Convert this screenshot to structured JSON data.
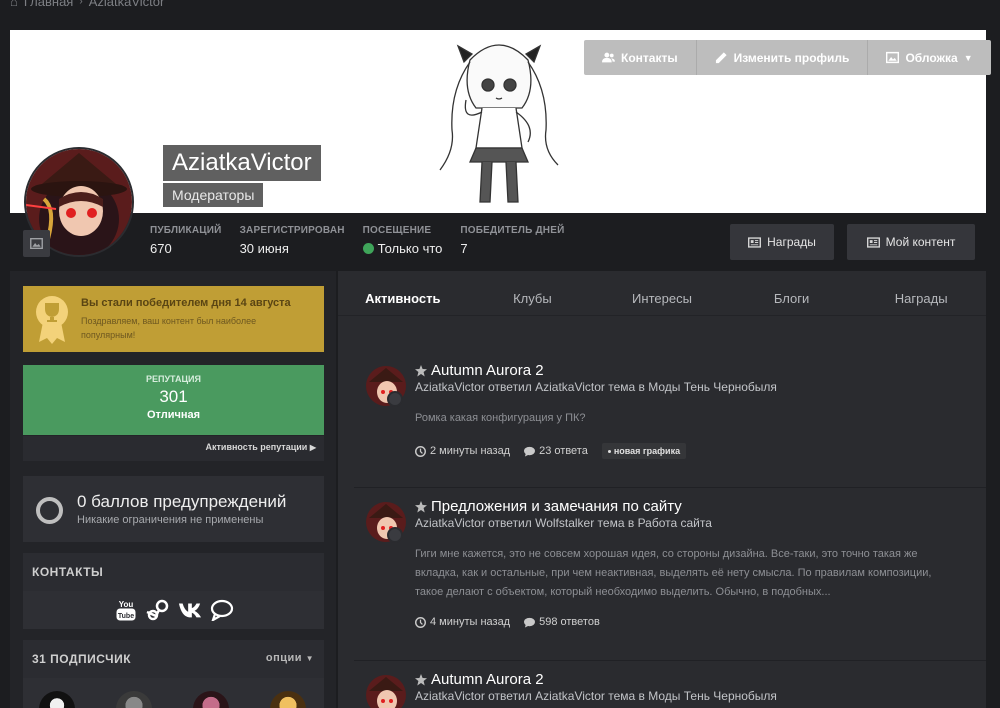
{
  "breadcrumb": {
    "home": "Главная",
    "current": "AziatkaVictor"
  },
  "cover_buttons": [
    {
      "label": "Контакты",
      "icon": "users-icon"
    },
    {
      "label": "Изменить профиль",
      "icon": "pencil-icon"
    },
    {
      "label": "Обложка",
      "icon": "image-icon"
    }
  ],
  "profile": {
    "name": "AziatkaVictor",
    "group": "Модераторы"
  },
  "stats": [
    {
      "label": "Публикаций",
      "value": "670"
    },
    {
      "label": "Зарегистрирован",
      "value": "30 июня"
    },
    {
      "label": "Посещение",
      "value": "Только что"
    },
    {
      "label": "Победитель дней",
      "value": "7"
    }
  ],
  "header_buttons": {
    "awards": "Награды",
    "my_content": "Мой контент"
  },
  "award": {
    "title": "Вы стали победителем дня 14 августа",
    "text": "Поздравляем, ваш контент был наиболее популярным!"
  },
  "reputation": {
    "label": "Репутация",
    "value": "301",
    "status": "Отличная",
    "link": "Активность репутации"
  },
  "warnings": {
    "title": "0 баллов предупреждений",
    "text": "Никакие ограничения не применены"
  },
  "contacts": {
    "heading": "Контакты",
    "icons": [
      "youtube-icon",
      "steam-icon",
      "vk-icon",
      "chat-icon"
    ]
  },
  "followers": {
    "heading": "31 подписчик",
    "options": "опции"
  },
  "tabs": [
    "Активность",
    "Клубы",
    "Интересы",
    "Блоги",
    "Награды"
  ],
  "posts": [
    {
      "title": "Autumn Aurora 2",
      "meta": "AziatkaVictor ответил AziatkaVictor тема в Моды Тень Чернобыля",
      "body": "Ромка какая конфигурация у ПК?",
      "time": "2 минуты назад",
      "replies": "23 ответа",
      "tag": "новая графика"
    },
    {
      "title": "Предложения и замечания по сайту",
      "meta": "AziatkaVictor ответил Wolfstalker тема в Работа сайта",
      "body": "Гиги мне кажется, это не совсем хорошая идея, со стороны дизайна. Все-таки, это точно такая же вкладка, как и остальные, при чем неактивная, выделять её нету смысла. По правилам композиции, такое делают с объектом, который необходимо выделить. Обычно, в подобных...",
      "time": "4 минуты назад",
      "replies": "598 ответов"
    },
    {
      "title": "Autumn Aurora 2",
      "meta": "AziatkaVictor ответил AziatkaVictor тема в Моды Тень Чернобыля"
    }
  ],
  "colors": {
    "award": "#c09e35",
    "reputation": "#4a9a5f",
    "online": "#3fa55a"
  }
}
